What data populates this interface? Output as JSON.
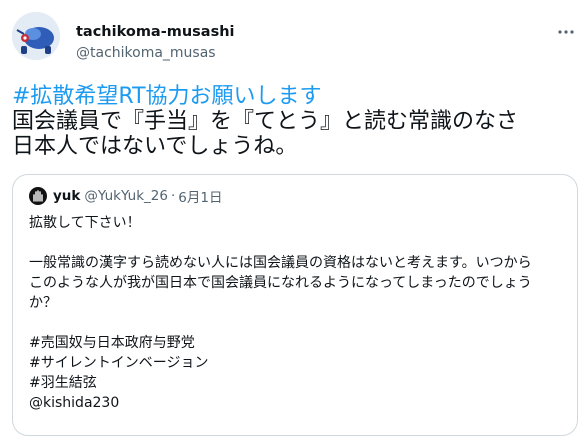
{
  "tweet": {
    "author_name": "tachikoma-musashi",
    "author_handle": "@tachikoma_musas",
    "hashtag": "#拡散希望RT協力お願いします",
    "lines": [
      "国会議員で『手当』を『てとう』と読む常識のなさ",
      "日本人ではないでしょうね。"
    ]
  },
  "quote": {
    "name": "yuk",
    "handle": "@YukYuk_26",
    "separator": "·",
    "date": "6月1日",
    "lines": [
      "拡散して下さい！",
      "",
      "一般常識の漢字すら読めない人には国会議員の資格はないと考えます。いつから",
      "このような人が我が国日本で国会議員になれるようになってしまったのでしょう",
      "か？",
      "",
      "#売国奴与日本政府与野党",
      "#サイレントインベージョン",
      "#羽生結弦",
      " @kishida230"
    ]
  },
  "icons": {
    "avatar": "robot-avatar-icon",
    "more": "more-options-icon",
    "quote_avatar": "hand-avatar-icon"
  },
  "colors": {
    "link": "#1d9bf0",
    "secondary": "#536471",
    "border": "#cfd9de"
  }
}
